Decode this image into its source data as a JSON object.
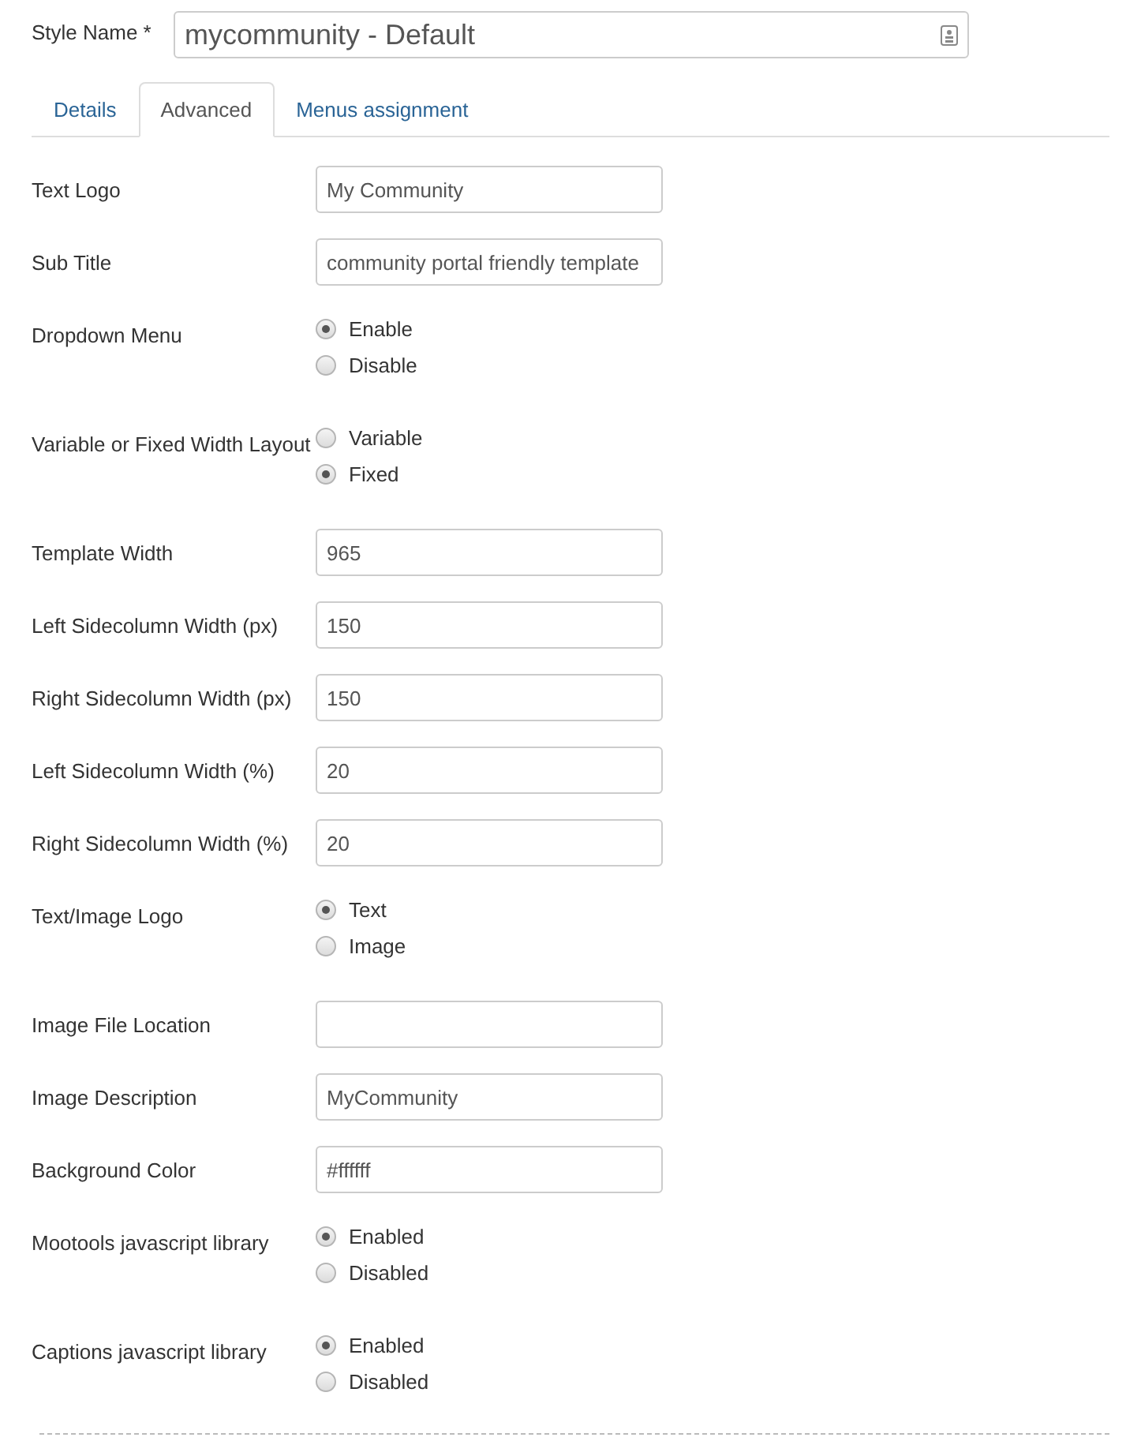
{
  "style_name": {
    "label": "Style Name *",
    "value": "mycommunity - Default"
  },
  "tabs": [
    {
      "label": "Details",
      "selected": false
    },
    {
      "label": "Advanced",
      "selected": true
    },
    {
      "label": "Menus assignment",
      "selected": false
    }
  ],
  "fields": [
    {
      "kind": "text",
      "label": "Text Logo",
      "value": "My Community"
    },
    {
      "kind": "text",
      "label": "Sub Title",
      "value": "community portal friendly template"
    },
    {
      "kind": "radio",
      "label": "Dropdown Menu",
      "options": [
        {
          "label": "Enable",
          "selected": true
        },
        {
          "label": "Disable",
          "selected": false
        }
      ]
    },
    {
      "kind": "radio",
      "label": "Variable or Fixed Width Layout",
      "options": [
        {
          "label": "Variable",
          "selected": false
        },
        {
          "label": "Fixed",
          "selected": true
        }
      ]
    },
    {
      "kind": "text",
      "label": "Template Width",
      "value": "965"
    },
    {
      "kind": "text",
      "label": "Left Sidecolumn Width (px)",
      "value": "150"
    },
    {
      "kind": "text",
      "label": "Right Sidecolumn Width (px)",
      "value": "150"
    },
    {
      "kind": "text",
      "label": "Left Sidecolumn Width (%)",
      "value": "20"
    },
    {
      "kind": "text",
      "label": "Right Sidecolumn Width (%)",
      "value": "20"
    },
    {
      "kind": "radio",
      "label": "Text/Image Logo",
      "options": [
        {
          "label": "Text",
          "selected": true
        },
        {
          "label": "Image",
          "selected": false
        }
      ]
    },
    {
      "kind": "text",
      "label": "Image File Location"
    },
    {
      "kind": "text",
      "label": "Image Description",
      "value": "MyCommunity"
    },
    {
      "kind": "text",
      "label": "Background Color",
      "value": "#ffffff"
    },
    {
      "kind": "radio",
      "label": "Mootools javascript library",
      "options": [
        {
          "label": "Enabled",
          "selected": true
        },
        {
          "label": "Disabled",
          "selected": false
        }
      ]
    },
    {
      "kind": "radio",
      "label": "Captions javascript library",
      "options": [
        {
          "label": "Enabled",
          "selected": true
        },
        {
          "label": "Disabled",
          "selected": false
        }
      ]
    }
  ]
}
